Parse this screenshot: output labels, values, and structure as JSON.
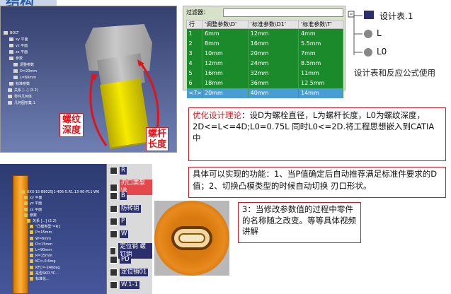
{
  "heading": "结构",
  "cad1": {
    "tree": [
      "BOLT",
      "xy 平面",
      "yz 平面",
      "zx 平面",
      "参数",
      "调整参数",
      "D=20mm",
      "L=60mm",
      "标准参数",
      "关系 [...] (3.2)",
      "零件几何体",
      "几何图形集.1"
    ]
  },
  "bolt_labels": {
    "thread": "螺纹深度",
    "length": "螺杆长度"
  },
  "design_table": {
    "filter_label": "过滤器：",
    "columns": [
      "行",
      "'调整参数\\D'",
      "'标准参数\\D1'",
      "'标准参数\\T'"
    ],
    "rows": [
      [
        "1",
        "6mm",
        "12mm",
        "4mm"
      ],
      [
        "2",
        "8mm",
        "16mm",
        "5.5mm"
      ],
      [
        "3",
        "10mm",
        "20mm",
        "7mm"
      ],
      [
        "4",
        "12mm",
        "24mm",
        "8.5mm"
      ],
      [
        "5",
        "16mm",
        "32mm",
        "11mm"
      ],
      [
        "6",
        "18mm",
        "36mm",
        "12.5mm"
      ],
      [
        "<7>",
        "20mm",
        "40mm",
        "14mm"
      ]
    ],
    "selected_row": 6
  },
  "ctree": {
    "items": [
      "设计表.1",
      "L",
      "L0"
    ]
  },
  "captions": {
    "table_caption": "设计表和反应公式使用",
    "opt_prefix": "优化设计理论",
    "opt_body": "：设D为螺栓直径，L为螺杆长度，L0为螺纹深度，",
    "opt_body2": "2D<=L<=4D;L0=0.75L 同时L0<=2D.将工程思想嵌入到CATIA中",
    "features": "具体可以实现的功能：1、当P值确定后自动推荐满足标准件要求的D值；2、切换凸模类型的时候自动切换   刃口形状。",
    "note3": "3：当修改参数值的过程中零件的名称随之改变。等等具体视频讲解"
  },
  "cad2": {
    "tree": [
      "XXX-15-B8025J1-406-5.R1.13-90-P11-W6",
      "xy 平面",
      "yz 平面",
      "zx 平面",
      "参数",
      "关系 [...] (2.2)",
      "\"凸模类型\"=R1",
      "P=15mm",
      "W=6mm",
      "D=15mm",
      "L=90mm",
      "R=15mm",
      "KC=-0.6mg",
      "KFC=-240deg",
      "是否SKD.YC...",
      "标准化..."
    ],
    "strip": [
      "R",
      "刃口类型\\R",
      "B",
      "防转销",
      "P",
      "W",
      "定位销 螺钉销",
      "PD",
      "定位销01",
      "W.1-1"
    ],
    "strip_selected": 1
  }
}
